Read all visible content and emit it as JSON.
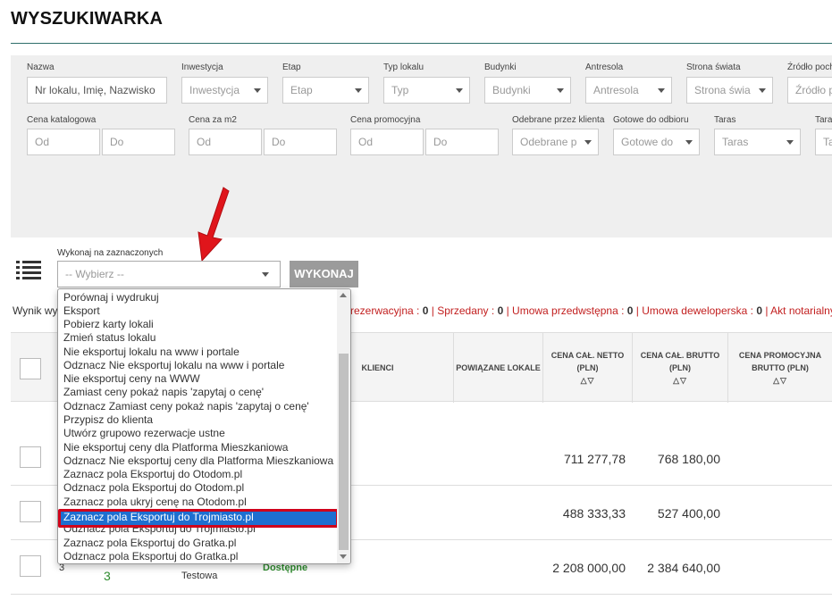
{
  "page": {
    "title": "WYSZUKIWARKA"
  },
  "filters": {
    "row1": [
      {
        "label": "Nazwa",
        "value": "Nr lokalu, Imię, Nazwisko",
        "kind": "input"
      },
      {
        "label": "Inwestycja",
        "value": "Inwestycja",
        "kind": "select"
      },
      {
        "label": "Etap",
        "value": "Etap",
        "kind": "select"
      },
      {
        "label": "Typ lokalu",
        "value": "Typ",
        "kind": "select"
      },
      {
        "label": "Budynki",
        "value": "Budynki",
        "kind": "select"
      },
      {
        "label": "Antresola",
        "value": "Antresola",
        "kind": "select"
      },
      {
        "label": "Strona świata",
        "value": "Strona świa",
        "kind": "select"
      },
      {
        "label": "Źródło poch",
        "value": "Źródło p",
        "kind": "input"
      }
    ],
    "row2": {
      "price_catalog": {
        "label": "Cena katalogowa",
        "from": "Od",
        "to": "Do"
      },
      "price_m2": {
        "label": "Cena za m2",
        "from": "Od",
        "to": "Do"
      },
      "price_promo": {
        "label": "Cena promocyjna",
        "from": "Od",
        "to": "Do"
      },
      "received": {
        "label": "Odebrane przez klienta",
        "value": "Odebrane p"
      },
      "ready": {
        "label": "Gotowe do odbioru",
        "value": "Gotowe do"
      },
      "terrace": {
        "label": "Taras",
        "value": "Taras"
      },
      "terrace2": {
        "label": "Tara",
        "value": "Ta"
      }
    }
  },
  "bulk": {
    "label": "Wykonaj na zaznaczonych",
    "placeholder": "-- Wybierz --",
    "button": "WYKONAJ",
    "options": [
      "Porównaj i wydrukuj",
      "Eksport",
      "Pobierz karty lokali",
      "Zmień status lokalu",
      "Nie eksportuj lokalu na www i portale",
      "Odznacz Nie eksportuj lokalu na www i portale",
      "Nie eksportuj ceny na WWW",
      "Zamiast ceny pokaż napis 'zapytaj o cenę'",
      "Odznacz Zamiast ceny pokaż napis 'zapytaj o cenę'",
      "Przypisz do klienta",
      "Utwórz grupowo rezerwacje ustne",
      "Nie eksportuj ceny dla Platforma Mieszkaniowa",
      "Odznacz Nie eksportuj ceny dla Platforma Mieszkaniowa",
      "Zaznacz pola Eksportuj do Otodom.pl",
      "Odznacz pola Eksportuj do Otodom.pl",
      "Zaznacz pola ukryj cenę na Otodom.pl",
      "Zaznacz pola Eksportuj do Trojmiasto.pl",
      "Odznacz pola Eksportuj do Trojmiasto.pl",
      "Zaznacz pola Eksportuj do Gratka.pl",
      "Odznacz pola Eksportuj do Gratka.pl"
    ],
    "highlighted": "Zaznacz pola Eksportuj do Trojmiasto.pl"
  },
  "results": {
    "prefix": "Wynik wy",
    "stats": [
      {
        "label": "rezerwacyjna : ",
        "value": "0"
      },
      {
        "label": "Sprzedany : ",
        "value": "0"
      },
      {
        "label": "Umowa przedwstępna : ",
        "value": "0"
      },
      {
        "label": "Umowa deweloperska : ",
        "value": "0"
      },
      {
        "label": "Akt notarialny : ",
        "value": ""
      }
    ]
  },
  "table": {
    "headers": {
      "clients": "KLIENCI",
      "related": "POWIĄZANE LOKALE",
      "net_l1": "CENA CAŁ. NETTO",
      "net_l2": "(PLN)",
      "gross_l1": "CENA CAŁ. BRUTTO",
      "gross_l2": "(PLN)",
      "promo_l1": "CENA PROMOCYJNA",
      "promo_l2": "BRUTTO (PLN)",
      "sort": "△▽"
    },
    "rows": [
      {
        "net": "711 277,78",
        "gross": "768 180,00"
      },
      {
        "net": "488 333,33",
        "gross": "527 400,00"
      },
      {
        "index": "3",
        "green": "3",
        "name": "Testowa",
        "status": "Dostępne",
        "net": "2 208 000,00",
        "gross": "2 384 640,00"
      }
    ]
  },
  "colors": {
    "accent_line": "#2f6e6a",
    "highlight": "#1e6fd0",
    "callout": "#d0021b",
    "stat_red": "#c21f1f",
    "available_green": "#2e8b2e"
  }
}
